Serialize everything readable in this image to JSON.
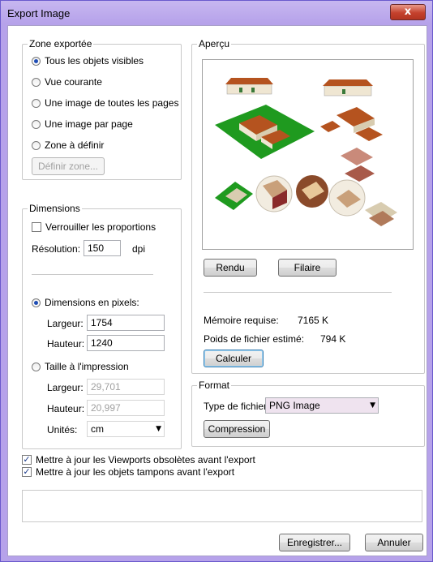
{
  "window": {
    "title": "Export Image",
    "close_glyph": "x"
  },
  "zone": {
    "legend": "Zone exportée",
    "options": [
      "Tous les objets visibles",
      "Vue courante",
      "Une image de toutes les pages",
      "Une image par page",
      "Zone à définir"
    ],
    "selected_index": 0,
    "define_button": "Définir zone..."
  },
  "dimensions": {
    "legend": "Dimensions",
    "lock_label": "Verrouiller les proportions",
    "lock_checked": false,
    "resolution_label": "Résolution:",
    "resolution_value": "150",
    "dpi_unit": "dpi",
    "pixels_label": "Dimensions en pixels:",
    "pixels_selected": true,
    "width_label": "Largeur:",
    "width_value": "1754",
    "height_label": "Hauteur:",
    "height_value": "1240",
    "print_label": "Taille à l'impression",
    "print_width_label": "Largeur:",
    "print_width_value": "29,701",
    "print_height_label": "Hauteur:",
    "print_height_value": "20,997",
    "units_label": "Unités:",
    "units_value": "cm"
  },
  "preview": {
    "legend": "Aperçu",
    "render_button": "Rendu",
    "wireframe_button": "Filaire",
    "memory_label": "Mémoire requise:",
    "memory_value": "7165 K",
    "filesize_label": "Poids de fichier estimé:",
    "filesize_value": "794 K",
    "compute_button": "Calculer"
  },
  "format": {
    "legend": "Format",
    "filetype_label": "Type de fichier",
    "filetype_value": "PNG Image",
    "compression_button": "Compression"
  },
  "options": {
    "update_viewports": "Mettre à jour les Viewports obsolètes avant l'export",
    "update_viewports_checked": true,
    "update_buffers": "Mettre à jour les objets tampons avant l'export",
    "update_buffers_checked": true
  },
  "footer": {
    "save_button": "Enregistrer...",
    "cancel_button": "Annuler"
  },
  "colors": {
    "accent": "#1e4db5",
    "grass": "#1f9a1f",
    "roof": "#b5531f",
    "wall": "#efe6d2",
    "filetype_bg": "#efe3ef"
  }
}
